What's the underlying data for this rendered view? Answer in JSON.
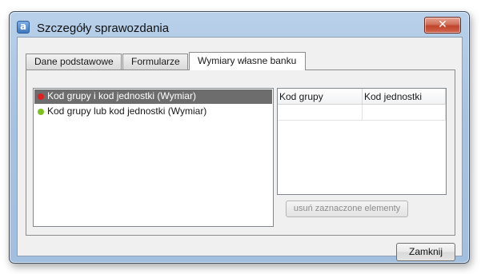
{
  "window": {
    "title": "Szczegóły sprawozdania",
    "app_icon_glyph": "a",
    "close_glyph": "✕"
  },
  "tabs": [
    {
      "label": "Dane podstawowe",
      "active": false
    },
    {
      "label": "Formularze",
      "active": false
    },
    {
      "label": "Wymiary własne banku",
      "active": true
    }
  ],
  "dimensions": [
    {
      "label": "Kod grupy i kod jednostki (Wymiar)",
      "dot_color": "#e02020",
      "selected": true
    },
    {
      "label": "Kod grupy lub kod jednostki (Wymiar)",
      "dot_color": "#7cc21e",
      "selected": false
    }
  ],
  "grid": {
    "columns": [
      "Kod grupy",
      "Kod jednostki"
    ],
    "rows": [
      [
        "",
        ""
      ]
    ]
  },
  "buttons": {
    "remove_selected": "usuń zaznaczone elementy",
    "close": "Zamknij"
  },
  "colors": {
    "selection": "#6d6d6d",
    "close_button": "#c0442a"
  }
}
